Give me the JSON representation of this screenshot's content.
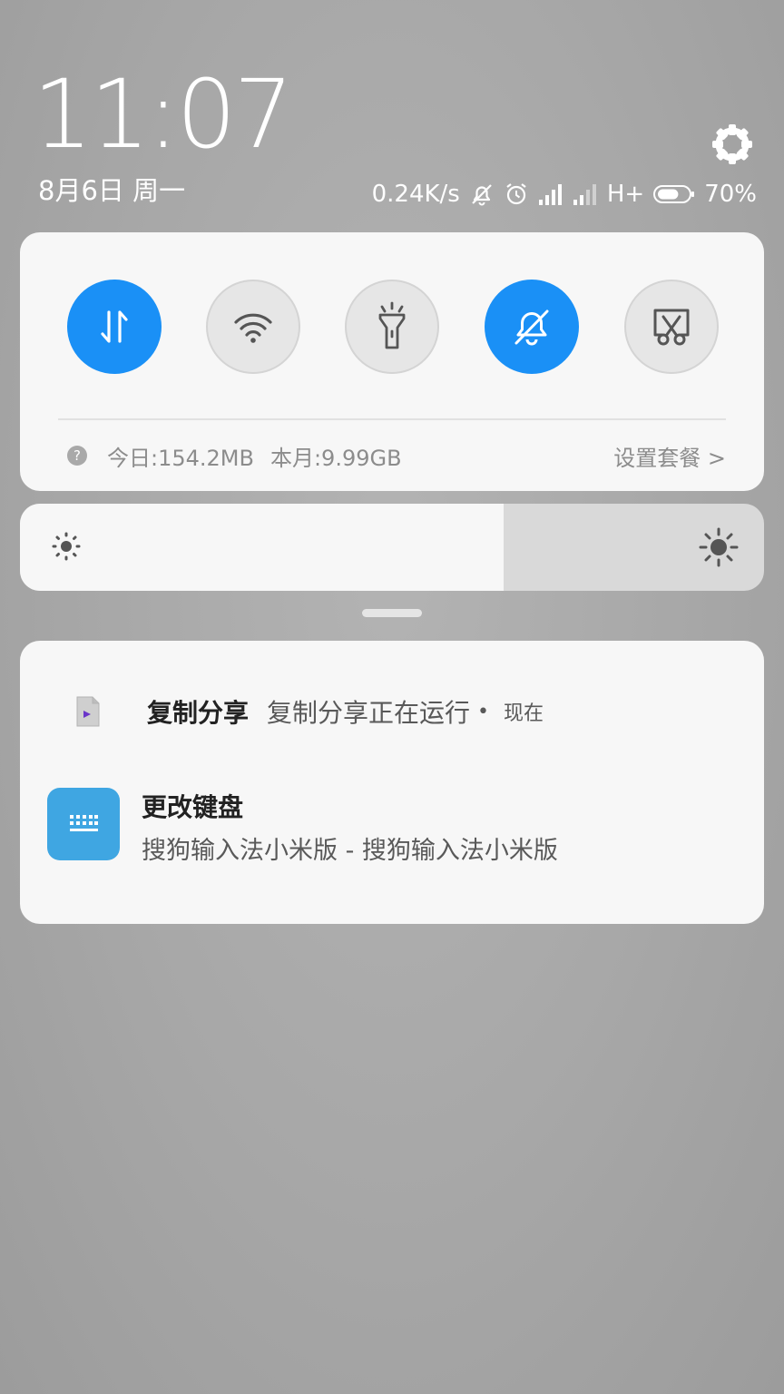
{
  "header": {
    "time": "11:07",
    "date": "8月6日 周一"
  },
  "status_bar": {
    "net_speed": "0.24K/s",
    "network_type": "H+",
    "battery_percent": "70%",
    "battery_level": 0.7
  },
  "quick_settings": {
    "toggles": [
      {
        "name": "mobile-data",
        "icon": "data-arrows-icon",
        "state": "on"
      },
      {
        "name": "wifi",
        "icon": "wifi-icon",
        "state": "off"
      },
      {
        "name": "flashlight",
        "icon": "flashlight-icon",
        "state": "off"
      },
      {
        "name": "mute",
        "icon": "bell-off-icon",
        "state": "on"
      },
      {
        "name": "screenshot",
        "icon": "screenshot-scissors-icon",
        "state": "off"
      }
    ],
    "data_usage": {
      "today": "今日:154.2MB",
      "month": "本月:9.99GB",
      "plan_link": "设置套餐 >"
    }
  },
  "brightness": {
    "level": 0.65
  },
  "notifications": [
    {
      "app_name": "复制分享",
      "text": "复制分享正在运行",
      "separator": "•",
      "time": "现在"
    },
    {
      "title": "更改键盘",
      "text": "搜狗输入法小米版 - 搜狗输入法小米版"
    }
  ],
  "colors": {
    "accent": "#1a90f6",
    "keyboard_icon": "#3fa6e2",
    "panel": "#f7f7f7"
  }
}
